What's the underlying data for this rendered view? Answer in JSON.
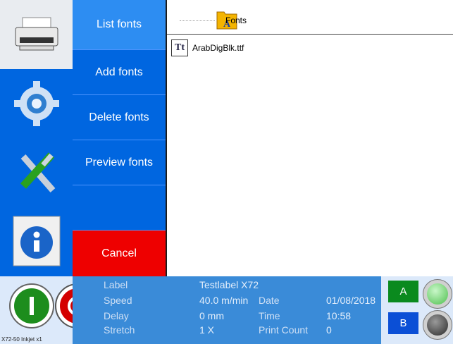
{
  "menu": {
    "items": [
      {
        "label": "List fonts"
      },
      {
        "label": "Add fonts"
      },
      {
        "label": "Delete fonts"
      },
      {
        "label": "Preview fonts"
      },
      {
        "label": ""
      },
      {
        "label": "Cancel"
      }
    ]
  },
  "tree": {
    "folder": "Fonts",
    "file": "ArabDigBlk.ttf"
  },
  "status": {
    "labels": [
      "Label",
      "Speed",
      "Delay",
      "Stretch"
    ],
    "values": [
      "Testlabel X72",
      "40.0 m/min",
      "0 mm",
      "1 X"
    ],
    "labels2": [
      "Date",
      "Time",
      "Print Count"
    ],
    "values2": [
      "01/08/2018",
      "10:58",
      "0"
    ],
    "buttonA": "A",
    "buttonB": "B"
  },
  "footer": "X72-50 Inkjet x1",
  "colors": {
    "accent": "#0066e0",
    "cancel": "#ee0000",
    "status": "#3a8bd8"
  }
}
